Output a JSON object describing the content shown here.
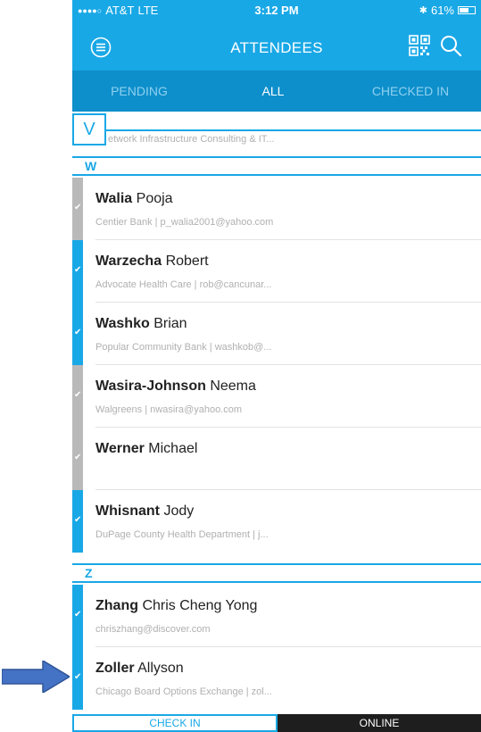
{
  "status_bar": {
    "signal": "●●●●○",
    "carrier": "AT&T",
    "network": "LTE",
    "time": "3:12 PM",
    "bluetooth": "✱",
    "battery": "61%",
    "battery_level": 0.61
  },
  "nav": {
    "title": "ATTENDEES",
    "icons": [
      "menu-icon",
      "qr-code-icon",
      "search-icon"
    ]
  },
  "tabs": [
    {
      "label": "PENDING",
      "active": false
    },
    {
      "label": "ALL",
      "active": true
    },
    {
      "label": "CHECKED IN",
      "active": false
    }
  ],
  "list": {
    "v_section": {
      "letter": "V",
      "partial_sub": "etwork Infrastructure Consulting & IT..."
    },
    "sections": [
      {
        "letter": "W",
        "rows": [
          {
            "last": "Walia",
            "first": "Pooja",
            "sub": "Centier Bank | p_walia2001@yahoo.com",
            "checked_in": false
          },
          {
            "last": "Warzecha",
            "first": "Robert",
            "sub": "Advocate Health Care | rob@cancunar...",
            "checked_in": true
          },
          {
            "last": "Washko",
            "first": "Brian",
            "sub": "Popular Community Bank | washkob@...",
            "checked_in": true
          },
          {
            "last": "Wasira-Johnson",
            "first": "Neema",
            "sub": "Walgreens | nwasira@yahoo.com",
            "checked_in": false
          },
          {
            "last": "Werner",
            "first": "Michael",
            "sub": "",
            "checked_in": false
          },
          {
            "last": "Whisnant",
            "first": "Jody",
            "sub": "DuPage County Health Department | j...",
            "checked_in": true
          }
        ]
      },
      {
        "letter": "Z",
        "rows": [
          {
            "last": "Zhang",
            "first": "Chris Cheng Yong",
            "sub": "chriszhang@discover.com",
            "checked_in": true
          },
          {
            "last": "Zoller",
            "first": "Allyson",
            "sub": "Chicago Board Options Exchange | zol...",
            "checked_in": true
          }
        ]
      }
    ]
  },
  "bottom": {
    "check_in_label": "CHECK IN",
    "online_label": "ONLINE"
  },
  "colors": {
    "accent": "#19a8e6",
    "tab_bar": "#0d8fcb",
    "unchecked_bar": "#b9b9b9",
    "arrow": "#4472c4"
  }
}
